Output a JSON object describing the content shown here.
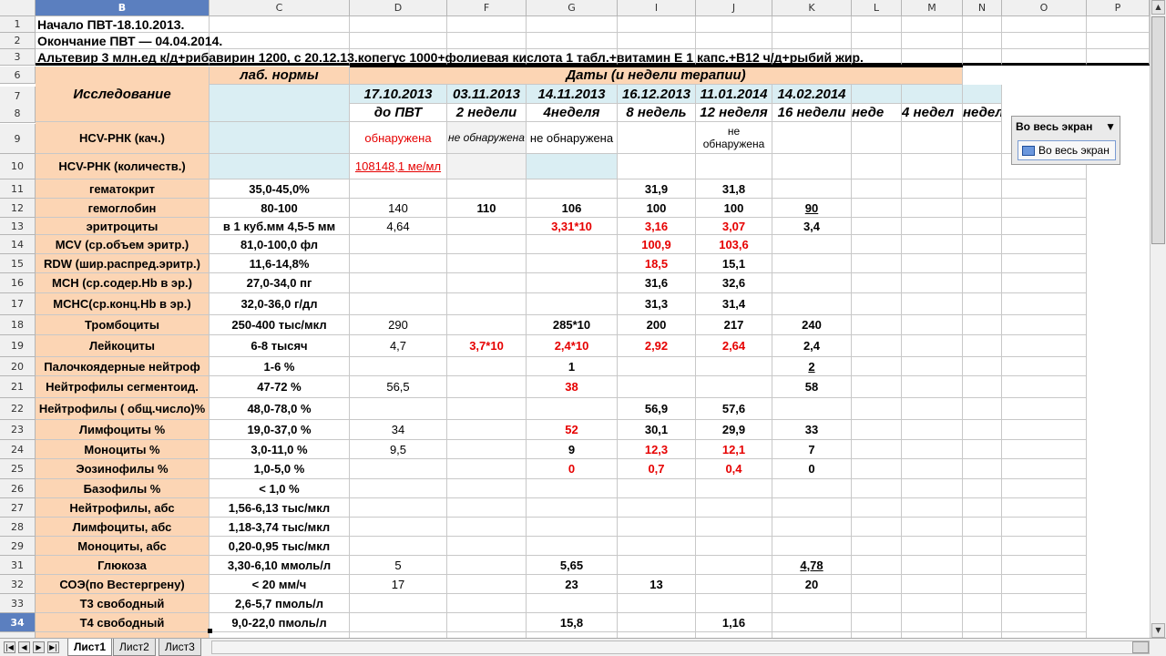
{
  "columns": [
    "B",
    "C",
    "D",
    "F",
    "G",
    "I",
    "J",
    "K",
    "L",
    "M",
    "N",
    "O",
    "P"
  ],
  "selected_column": "B",
  "selected_row": "34",
  "title_rows": [
    {
      "row": "1",
      "text": "Начало ПВТ-18.10.2013."
    },
    {
      "row": "2",
      "text": "Окончание ПВТ — 04.04.2014."
    },
    {
      "row": "3",
      "text": "Альтевир 3 млн.ед к/д+рибавирин 1200, с  20.12.13.копегус 1000+фолиевая кислота 1 табл.+витамин Е 1 капс.+В12 ч/д+рыбий жир."
    }
  ],
  "header": {
    "study": "Исследование",
    "lab_norms": "лаб. нормы",
    "dates_title": "Даты   (и  недели  терапии)",
    "dates": [
      "17.10.2013",
      "03.11.2013",
      "14.11.2013",
      "16.12.2013",
      "11.01.2014",
      "14.02.2014",
      "",
      "",
      ""
    ],
    "weeks": [
      "до ПВТ",
      "2 недели",
      "4неделя",
      "8 недель",
      "12 неделя",
      "16 недели",
      "неде",
      "4 недел",
      "недел"
    ]
  },
  "rows": [
    {
      "row": "9",
      "name": "HCV-РНК (кач.)",
      "norm": "",
      "vals": [
        {
          "t": "обнаружена",
          "red": true,
          "normal": true
        },
        {
          "t": "не обнаружена",
          "gray": true,
          "small": true,
          "it": true
        },
        {
          "t": "не обнаружена",
          "normal": true
        },
        {
          "t": ""
        },
        {
          "t": "не обнаружена",
          "small": true
        },
        {
          "t": ""
        }
      ]
    },
    {
      "row": "10",
      "name": "HCV-РНК (количеств.)",
      "norm": "",
      "vals": [
        {
          "t": "108148,1 ме/мл",
          "red": true,
          "ul": true,
          "normal": true
        },
        {
          "t": "",
          "gray": true
        },
        {
          "t": "",
          "lblue": true
        },
        {
          "t": ""
        },
        {
          "t": ""
        },
        {
          "t": ""
        }
      ]
    },
    {
      "row": "11",
      "name": "гематокрит",
      "norm": "35,0-45,0%",
      "vals": [
        {
          "t": ""
        },
        {
          "t": ""
        },
        {
          "t": ""
        },
        {
          "t": "31,9"
        },
        {
          "t": "31,8"
        },
        {
          "t": ""
        }
      ]
    },
    {
      "row": "12",
      "name": "гемоглобин",
      "norm": "80-100",
      "vals": [
        {
          "t": "140",
          "normal": true
        },
        {
          "t": "110"
        },
        {
          "t": "106"
        },
        {
          "t": "100"
        },
        {
          "t": "100"
        },
        {
          "t": "90",
          "ul": true
        }
      ]
    },
    {
      "row": "13",
      "name": "эритроциты",
      "norm": "в 1 куб.мм 4,5-5 мм",
      "vals": [
        {
          "t": "4,64",
          "normal": true
        },
        {
          "t": ""
        },
        {
          "t": "3,31*10",
          "red": true
        },
        {
          "t": "3,16",
          "red": true
        },
        {
          "t": "3,07",
          "red": true
        },
        {
          "t": "3,4"
        }
      ]
    },
    {
      "row": "14",
      "name": "MCV (ср.объем эритр.)",
      "norm": "81,0-100,0 фл",
      "vals": [
        {
          "t": ""
        },
        {
          "t": ""
        },
        {
          "t": ""
        },
        {
          "t": "100,9",
          "red": true
        },
        {
          "t": "103,6",
          "red": true
        },
        {
          "t": ""
        }
      ]
    },
    {
      "row": "15",
      "name": "RDW (шир.распред.эритр.)",
      "norm": "11,6-14,8%",
      "vals": [
        {
          "t": ""
        },
        {
          "t": ""
        },
        {
          "t": ""
        },
        {
          "t": "18,5",
          "red": true
        },
        {
          "t": "15,1"
        },
        {
          "t": ""
        }
      ]
    },
    {
      "row": "16",
      "name": "MCH (ср.содер.Hb в эр.)",
      "norm": "27,0-34,0 пг",
      "vals": [
        {
          "t": ""
        },
        {
          "t": ""
        },
        {
          "t": ""
        },
        {
          "t": "31,6"
        },
        {
          "t": "32,6"
        },
        {
          "t": ""
        }
      ]
    },
    {
      "row": "17",
      "name": "MCHC(ср.конц.Hb в эр.)",
      "norm": "32,0-36,0 г/дл",
      "vals": [
        {
          "t": ""
        },
        {
          "t": ""
        },
        {
          "t": ""
        },
        {
          "t": "31,3"
        },
        {
          "t": "31,4"
        },
        {
          "t": ""
        }
      ]
    },
    {
      "row": "18",
      "name": "Тромбоциты",
      "norm": "250-400 тыс/мкл",
      "vals": [
        {
          "t": "290",
          "normal": true
        },
        {
          "t": ""
        },
        {
          "t": "285*10"
        },
        {
          "t": "200"
        },
        {
          "t": "217"
        },
        {
          "t": "240"
        }
      ]
    },
    {
      "row": "19",
      "name": "Лейкоциты",
      "norm": "6-8 тысяч",
      "vals": [
        {
          "t": "4,7",
          "normal": true
        },
        {
          "t": "3,7*10",
          "red": true
        },
        {
          "t": "2,4*10",
          "red": true
        },
        {
          "t": "2,92",
          "red": true
        },
        {
          "t": "2,64",
          "red": true
        },
        {
          "t": "2,4"
        }
      ]
    },
    {
      "row": "20",
      "name": "Палочкоядерные нейтроф",
      "norm": "1-6 %",
      "vals": [
        {
          "t": ""
        },
        {
          "t": ""
        },
        {
          "t": "1"
        },
        {
          "t": ""
        },
        {
          "t": ""
        },
        {
          "t": "2",
          "ul": true
        }
      ]
    },
    {
      "row": "21",
      "name": "Нейтрофилы сегментоид.",
      "norm": "47-72 %",
      "vals": [
        {
          "t": "56,5",
          "normal": true
        },
        {
          "t": ""
        },
        {
          "t": "38",
          "red": true
        },
        {
          "t": ""
        },
        {
          "t": ""
        },
        {
          "t": "58"
        }
      ]
    },
    {
      "row": "22",
      "name": "Нейтрофилы ( общ.число)%",
      "norm": "48,0-78,0 %",
      "vals": [
        {
          "t": ""
        },
        {
          "t": ""
        },
        {
          "t": ""
        },
        {
          "t": "56,9"
        },
        {
          "t": "57,6"
        },
        {
          "t": ""
        }
      ]
    },
    {
      "row": "23",
      "name": "Лимфоциты %",
      "norm": "19,0-37,0 %",
      "vals": [
        {
          "t": "34",
          "normal": true
        },
        {
          "t": ""
        },
        {
          "t": "52",
          "red": true
        },
        {
          "t": "30,1"
        },
        {
          "t": "29,9"
        },
        {
          "t": "33"
        }
      ]
    },
    {
      "row": "24",
      "name": "Моноциты %",
      "norm": "3,0-11,0 %",
      "vals": [
        {
          "t": "9,5",
          "normal": true
        },
        {
          "t": ""
        },
        {
          "t": "9"
        },
        {
          "t": "12,3",
          "red": true
        },
        {
          "t": "12,1",
          "red": true
        },
        {
          "t": "7"
        }
      ]
    },
    {
      "row": "25",
      "name": "Эозинофилы %",
      "norm": "1,0-5,0 %",
      "vals": [
        {
          "t": ""
        },
        {
          "t": ""
        },
        {
          "t": "0",
          "red": true
        },
        {
          "t": "0,7",
          "red": true
        },
        {
          "t": "0,4",
          "red": true
        },
        {
          "t": "0"
        }
      ]
    },
    {
      "row": "26",
      "name": "Базофилы %",
      "norm": "< 1,0 %",
      "vals": [
        {
          "t": ""
        },
        {
          "t": ""
        },
        {
          "t": ""
        },
        {
          "t": ""
        },
        {
          "t": ""
        },
        {
          "t": ""
        }
      ]
    },
    {
      "row": "27",
      "name": "Нейтрофилы, абс",
      "norm": "1,56-6,13 тыс/мкл",
      "vals": [
        {
          "t": ""
        },
        {
          "t": ""
        },
        {
          "t": ""
        },
        {
          "t": ""
        },
        {
          "t": ""
        },
        {
          "t": ""
        }
      ]
    },
    {
      "row": "28",
      "name": "Лимфоциты, абс",
      "norm": "1,18-3,74 тыс/мкл",
      "vals": [
        {
          "t": ""
        },
        {
          "t": ""
        },
        {
          "t": ""
        },
        {
          "t": ""
        },
        {
          "t": ""
        },
        {
          "t": ""
        }
      ]
    },
    {
      "row": "29",
      "name": "Моноциты, абс",
      "norm": "0,20-0,95 тыс/мкл",
      "vals": [
        {
          "t": ""
        },
        {
          "t": ""
        },
        {
          "t": ""
        },
        {
          "t": ""
        },
        {
          "t": ""
        },
        {
          "t": ""
        }
      ]
    },
    {
      "row": "31",
      "name": "Глюкоза",
      "norm": "3,30-6,10 ммоль/л",
      "vals": [
        {
          "t": "5",
          "normal": true
        },
        {
          "t": ""
        },
        {
          "t": "5,65"
        },
        {
          "t": ""
        },
        {
          "t": ""
        },
        {
          "t": "4,78",
          "ul": true
        }
      ]
    },
    {
      "row": "32",
      "name": "СОЭ(по Вестергрену)",
      "norm": "< 20 мм/ч",
      "vals": [
        {
          "t": "17",
          "normal": true
        },
        {
          "t": ""
        },
        {
          "t": "23"
        },
        {
          "t": "13"
        },
        {
          "t": ""
        },
        {
          "t": "20"
        }
      ]
    },
    {
      "row": "33",
      "name": "Т3 свободный",
      "norm": "2,6-5,7 пмоль/л",
      "vals": [
        {
          "t": ""
        },
        {
          "t": ""
        },
        {
          "t": ""
        },
        {
          "t": ""
        },
        {
          "t": ""
        },
        {
          "t": ""
        }
      ]
    },
    {
      "row": "34",
      "name": "Т4 свободный",
      "norm": "9,0-22,0 пмоль/л",
      "vals": [
        {
          "t": ""
        },
        {
          "t": ""
        },
        {
          "t": "15,8"
        },
        {
          "t": ""
        },
        {
          "t": "1,16"
        },
        {
          "t": ""
        }
      ]
    }
  ],
  "tabs": [
    "Лист1",
    "Лист2",
    "Лист3"
  ],
  "active_tab": "Лист1",
  "fullscreen": {
    "title": "Во весь экран",
    "button": "Во весь экран"
  },
  "colors": {
    "peach": "#fcd5b4",
    "light_blue": "#daeef3",
    "red": "#e60000",
    "selection": "#5b7fbf"
  }
}
